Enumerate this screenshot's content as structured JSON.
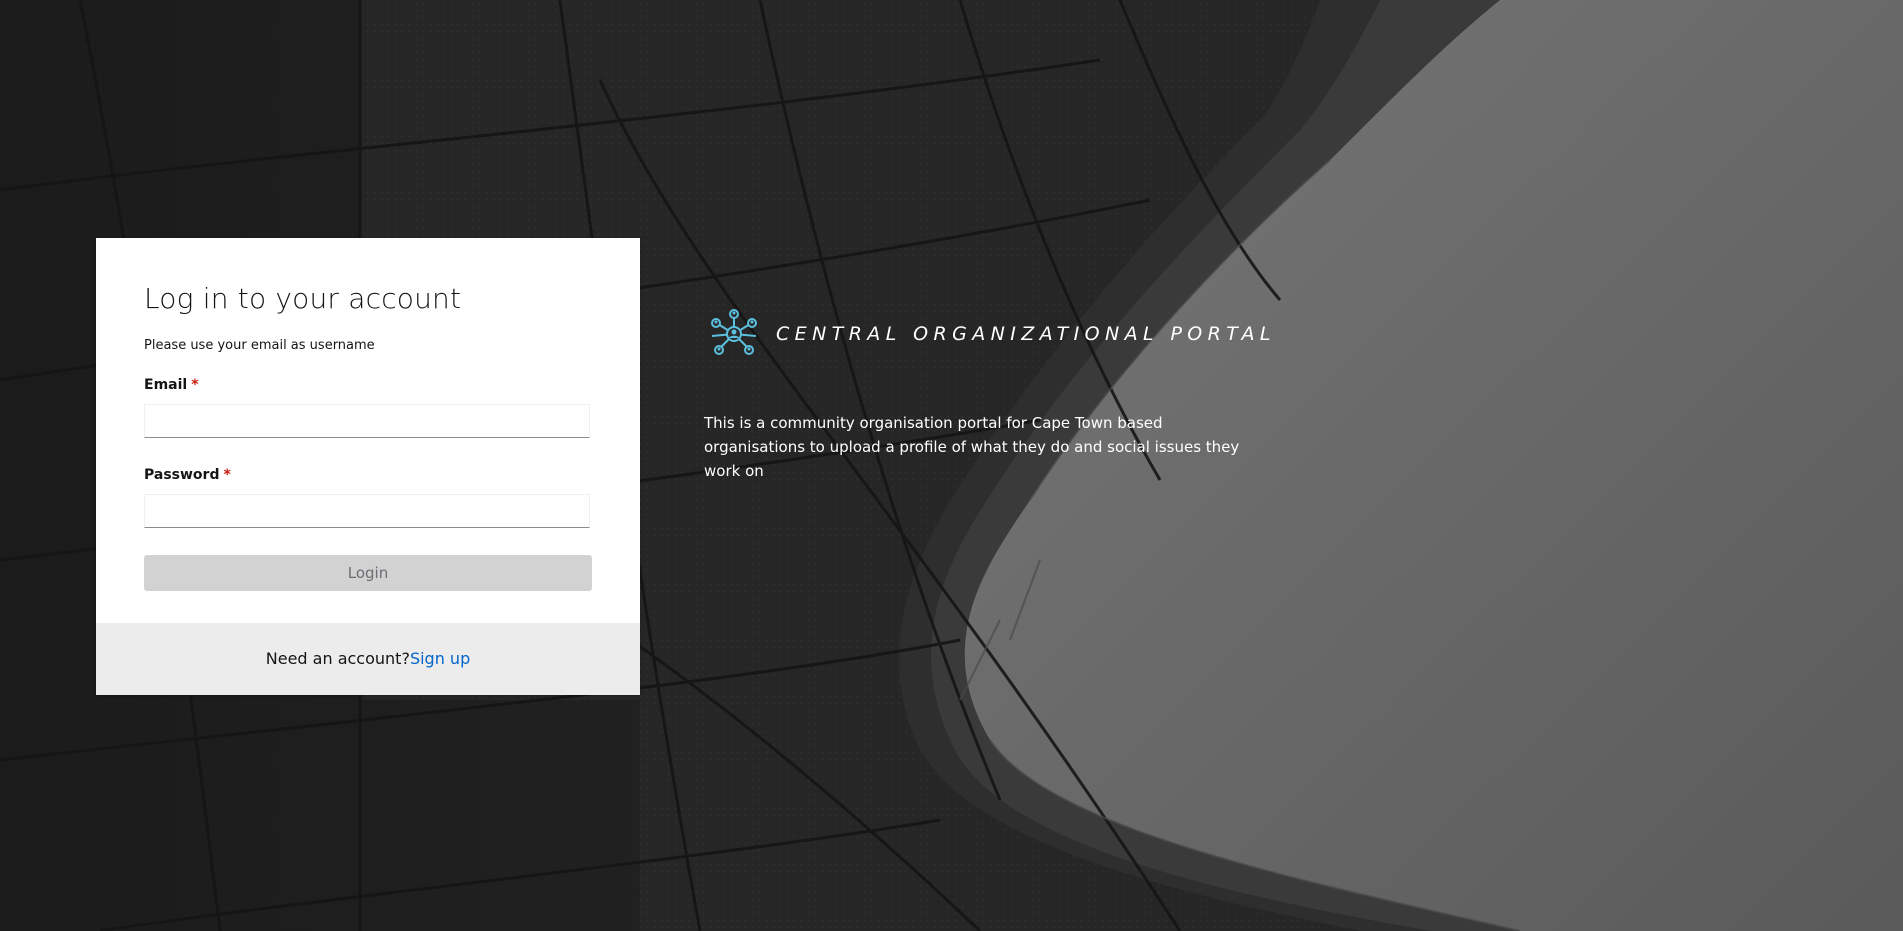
{
  "login": {
    "title": "Log in to your account",
    "subtitle": "Please use your email as username",
    "email_label": "Email",
    "email_required_marker": "*",
    "email_value": "",
    "password_label": "Password",
    "password_required_marker": "*",
    "password_value": "",
    "login_button_label": "Login",
    "footer_prompt": "Need an account?",
    "signup_link_label": "Sign up"
  },
  "brand": {
    "name": "CENTRAL ORGANIZATIONAL PORTAL",
    "icon": "network-people-icon",
    "icon_color": "#5bc0de"
  },
  "description": "This is a community organisation portal for Cape Town based organisations to upload a profile of what they do and social issues they work on",
  "colors": {
    "required_marker": "#c9190b",
    "link": "#0066cc",
    "login_button_disabled_bg": "#d2d2d2",
    "footer_bg": "#ececec",
    "page_background": "#242424"
  }
}
